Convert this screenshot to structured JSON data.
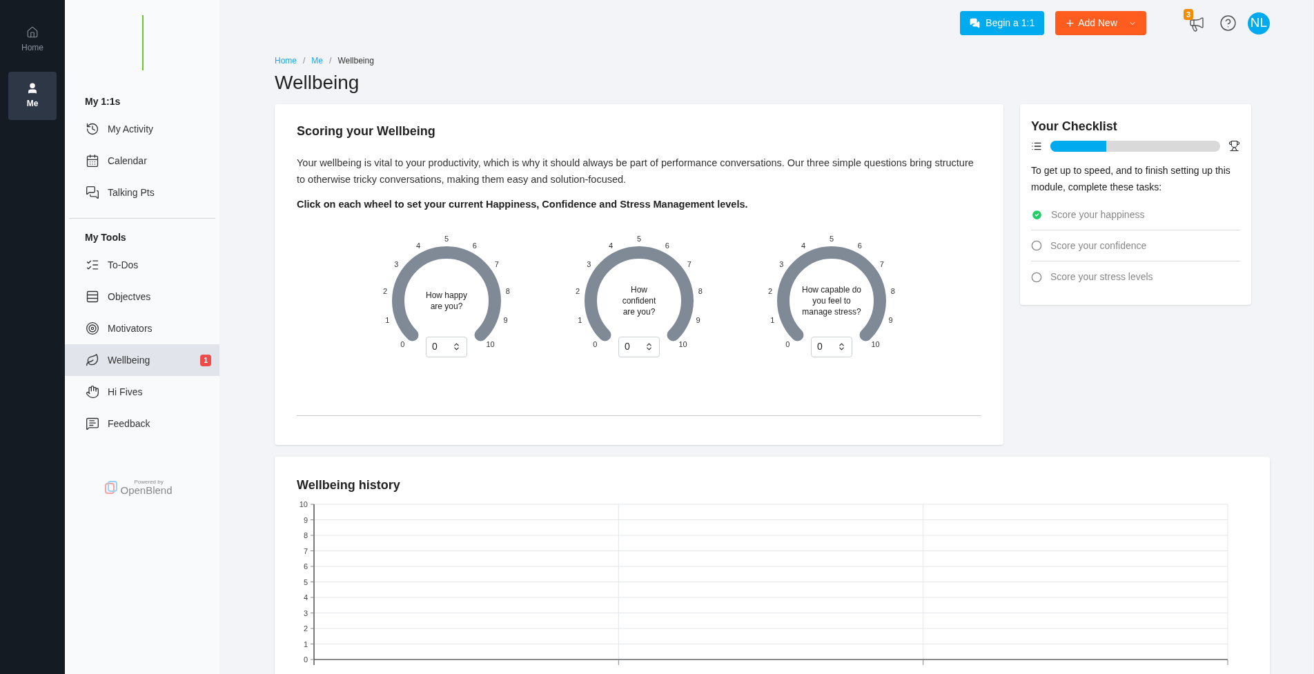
{
  "rail": {
    "items": [
      {
        "label": "Home",
        "selected": false
      },
      {
        "label": "Me",
        "selected": true
      }
    ]
  },
  "sidebar": {
    "sections": [
      {
        "title": "My 1:1s",
        "items": [
          {
            "label": "My Activity",
            "selected": false
          },
          {
            "label": "Calendar",
            "selected": false
          },
          {
            "label": "Talking Pts",
            "selected": false
          }
        ]
      },
      {
        "title": "My Tools",
        "items": [
          {
            "label": "To-Dos",
            "selected": false
          },
          {
            "label": "Objectves",
            "selected": false
          },
          {
            "label": "Motivators",
            "selected": false
          },
          {
            "label": "Wellbeing",
            "selected": true,
            "badge": "1"
          },
          {
            "label": "Hi Fives",
            "selected": false
          },
          {
            "label": "Feedback",
            "selected": false
          }
        ]
      }
    ],
    "powered_by": "Powered by",
    "brand": "OpenBlend"
  },
  "header": {
    "begin_button": "Begin a 1:1",
    "add_button": "Add New",
    "notification_count": "3",
    "avatar": "NL"
  },
  "breadcrumb_separator": "/",
  "breadcrumb": [
    {
      "label": "Home",
      "kind": "link"
    },
    {
      "label": "Me",
      "kind": "link"
    },
    {
      "label": "Wellbeing",
      "kind": "current"
    }
  ],
  "title": "Wellbeing",
  "scoring": {
    "title": "Scoring your Wellbeing",
    "intro": "Your wellbeing is vital to your productivity, which is why it should always be part of performance conversations. Our three simple questions bring structure to otherwise tricky conversations, making them easy and solution-focused.",
    "instruction": "Click on each wheel to set your current Happiness, Confidence and Stress Management levels.",
    "gauges": [
      {
        "question": "How happy\nare you?",
        "ticks": [
          "0",
          "1",
          "2",
          "3",
          "4",
          "5",
          "6",
          "7",
          "8",
          "9",
          "10"
        ],
        "value": "0"
      },
      {
        "question": "How\nconfident\nare you?",
        "ticks": [
          "0",
          "1",
          "2",
          "3",
          "4",
          "5",
          "6",
          "7",
          "8",
          "9",
          "10"
        ],
        "value": "0"
      },
      {
        "question": "How capable do\nyou feel to\nmanage stress?",
        "ticks": [
          "0",
          "1",
          "2",
          "3",
          "4",
          "5",
          "6",
          "7",
          "8",
          "9",
          "10"
        ],
        "value": "0"
      }
    ]
  },
  "checklist": {
    "title": "Your Checklist",
    "level": 0.33,
    "intro": "To get up to speed, and to finish setting up this module, complete these tasks:",
    "tasks": [
      {
        "label": "Score your happiness",
        "checked": true
      },
      {
        "label": "Score your confidence",
        "checked": false
      },
      {
        "label": "Score your stress levels",
        "checked": false
      }
    ]
  },
  "history": {
    "title": "Wellbeing history",
    "chart_data": {
      "type": "line",
      "grid": true,
      "categories": [
        null,
        null,
        null,
        null
      ],
      "values": [
        null,
        null,
        null,
        null
      ],
      "ylim": [
        0,
        10
      ],
      "yticks": [
        {
          "value": 0,
          "label": "0"
        },
        {
          "value": 1,
          "label": "1"
        },
        {
          "value": 2,
          "label": "2"
        },
        {
          "value": 3,
          "label": "3"
        },
        {
          "value": 4,
          "label": "4"
        },
        {
          "value": 5,
          "label": "5"
        },
        {
          "value": 6,
          "label": "6"
        },
        {
          "value": 7,
          "label": "7"
        },
        {
          "value": 8,
          "label": "8"
        },
        {
          "value": 9,
          "label": "9"
        },
        {
          "value": 10,
          "label": "10"
        }
      ]
    }
  }
}
